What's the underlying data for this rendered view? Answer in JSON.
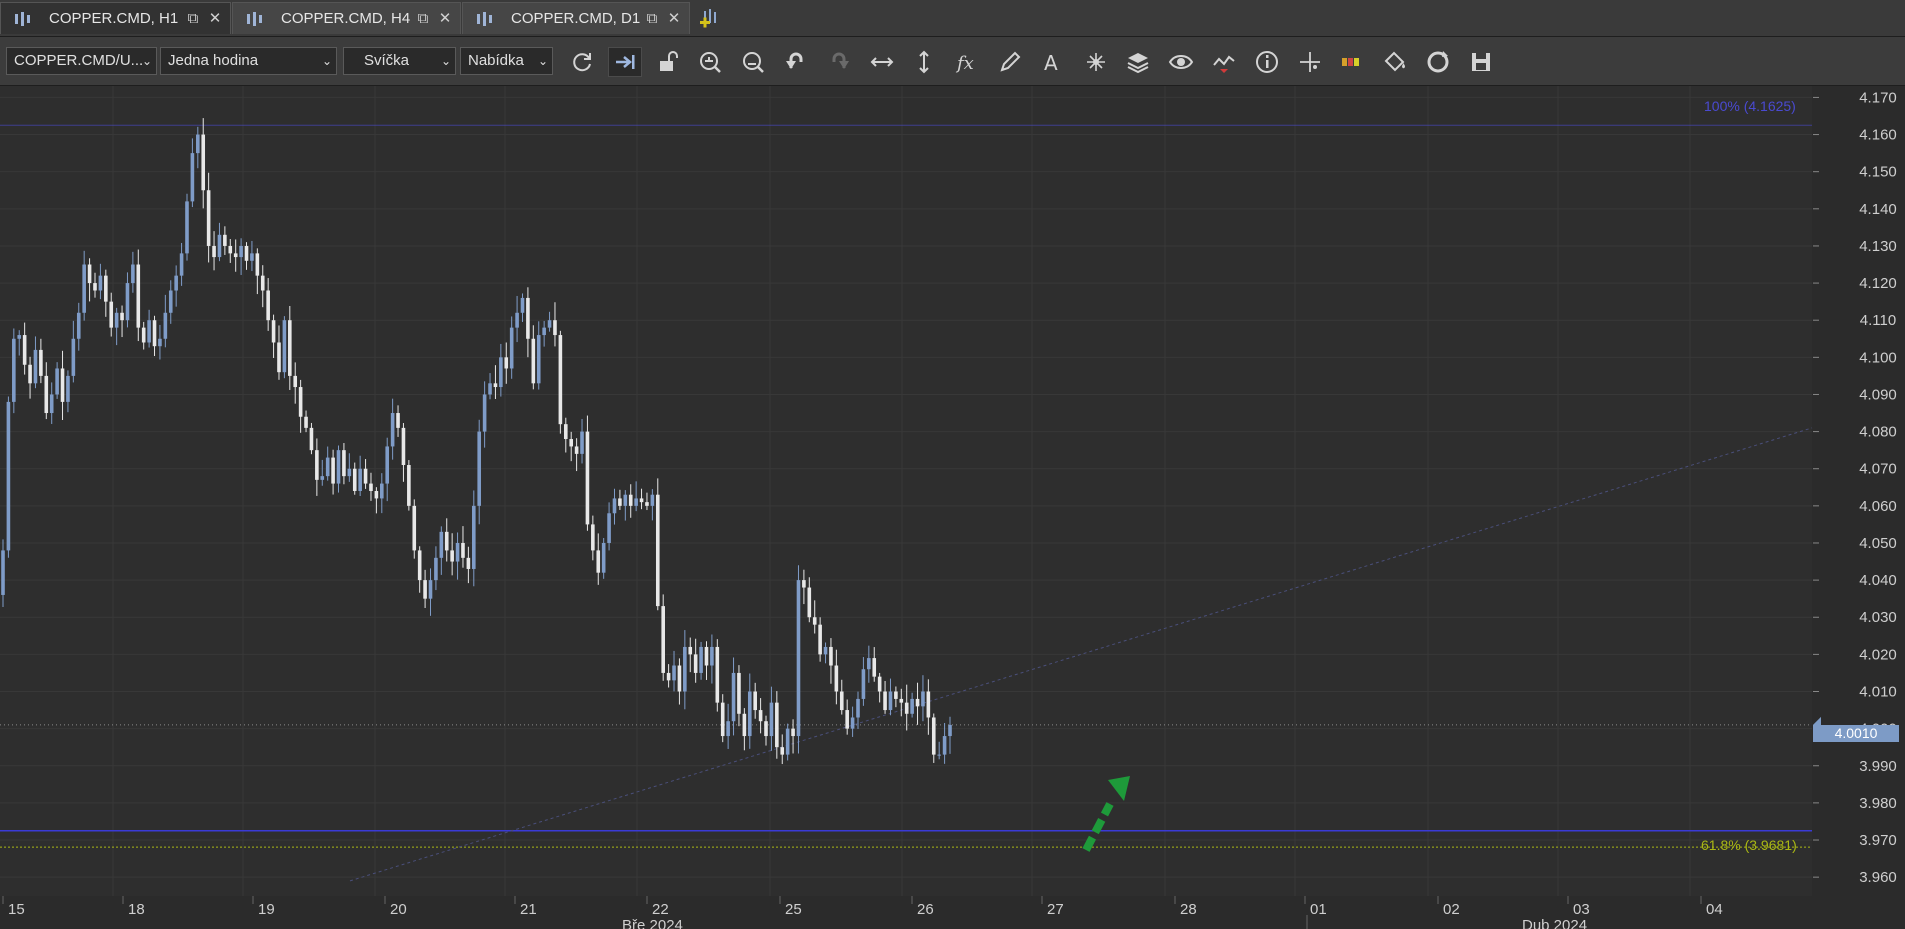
{
  "tabs": [
    {
      "label": "COPPER.CMD, H1",
      "active": true
    },
    {
      "label": "COPPER.CMD, H4",
      "active": false
    },
    {
      "label": "COPPER.CMD, D1",
      "active": false
    }
  ],
  "toolbar": {
    "instrument": "COPPER.CMD/U...",
    "period": "Jedna hodina",
    "chart_type": "Svíčka",
    "side": "Nabídka",
    "icons": [
      "refresh-icon",
      "autoshift-icon",
      "unlock-icon",
      "zoom-in-icon",
      "zoom-out-icon",
      "undo-icon",
      "redo-icon",
      "fit-horizontal-icon",
      "fit-vertical-icon",
      "indicators-icon",
      "pencil-icon",
      "text-icon",
      "objects-icon",
      "layers-icon",
      "eye-icon",
      "strategy-icon",
      "info-icon",
      "crosshair-icon",
      "heatmap-icon",
      "paint-bucket-icon",
      "reload-icon",
      "save-icon"
    ]
  },
  "chart_data": {
    "type": "candlestick",
    "instrument": "COPPER.CMD",
    "timeframe": "H1",
    "ylim": [
      3.956,
      4.172
    ],
    "y_ticks": [
      "4.170",
      "4.160",
      "4.150",
      "4.140",
      "4.130",
      "4.120",
      "4.110",
      "4.100",
      "4.090",
      "4.080",
      "4.070",
      "4.060",
      "4.050",
      "4.040",
      "4.030",
      "4.020",
      "4.010",
      "4.000",
      "3.990",
      "3.980",
      "3.970",
      "3.960"
    ],
    "x_ticks": [
      "15",
      "18",
      "19",
      "20",
      "21",
      "22",
      "25",
      "26",
      "27",
      "28",
      "01",
      "02",
      "03",
      "04"
    ],
    "x_groups": [
      "Bře 2024",
      "Dub 2024"
    ],
    "current_price": "4.0010",
    "fib_levels": [
      {
        "label": "100% (4.1625)",
        "value": 4.1625,
        "color": "#4a4ad0"
      },
      {
        "label": "61.8% (3.9681)",
        "value": 3.9681,
        "color": "#aab814"
      }
    ],
    "horizontal_line": {
      "value": 3.9725,
      "color": "#3a3ad6"
    },
    "trend_line": {
      "from": [
        "20",
        3.959
      ],
      "to": [
        "04+",
        4.081
      ]
    },
    "arrow": {
      "direction": "up",
      "color": "#1e9a3a"
    },
    "closes": [
      4.048,
      4.088,
      4.105,
      4.106,
      4.098,
      4.093,
      4.102,
      4.095,
      4.085,
      4.09,
      4.097,
      4.088,
      4.095,
      4.105,
      4.112,
      4.125,
      4.12,
      4.118,
      4.122,
      4.115,
      4.108,
      4.112,
      4.11,
      4.12,
      4.125,
      4.108,
      4.104,
      4.11,
      4.103,
      4.105,
      4.112,
      4.118,
      4.122,
      4.128,
      4.142,
      4.155,
      4.16,
      4.145,
      4.13,
      4.127,
      4.133,
      4.13,
      4.128,
      4.127,
      4.13,
      4.126,
      4.128,
      4.122,
      4.118,
      4.11,
      4.104,
      4.096,
      4.11,
      4.095,
      4.092,
      4.084,
      4.081,
      4.075,
      4.067,
      4.068,
      4.073,
      4.066,
      4.075,
      4.068,
      4.07,
      4.064,
      4.07,
      4.066,
      4.064,
      4.062,
      4.066,
      4.076,
      4.085,
      4.081,
      4.071,
      4.06,
      4.048,
      4.04,
      4.035,
      4.04,
      4.046,
      4.053,
      4.048,
      4.045,
      4.05,
      4.046,
      4.043,
      4.06,
      4.08,
      4.09,
      4.093,
      4.092,
      4.1,
      4.097,
      4.108,
      4.112,
      4.116,
      4.105,
      4.093,
      4.106,
      4.108,
      4.11,
      4.106,
      4.082,
      4.078,
      4.076,
      4.074,
      4.08,
      4.055,
      4.048,
      4.042,
      4.05,
      4.058,
      4.062,
      4.06,
      4.063,
      4.06,
      4.062,
      4.061,
      4.06,
      4.063,
      4.033,
      4.015,
      4.013,
      4.017,
      4.01,
      4.022,
      4.02,
      4.015,
      4.022,
      4.017,
      4.022,
      4.007,
      3.998,
      4.002,
      4.015,
      4.004,
      3.998,
      4.01,
      4.005,
      4.002,
      3.998,
      4.007,
      3.995,
      3.993,
      4.0,
      3.998,
      4.04,
      4.038,
      4.03,
      4.028,
      4.02,
      4.022,
      4.017,
      4.01,
      4.005,
      4.0,
      4.003,
      4.008,
      4.016,
      4.019,
      4.014,
      4.01,
      4.005,
      4.01,
      4.008,
      4.007,
      4.004,
      4.008,
      4.006,
      4.01,
      4.003,
      3.993,
      3.993,
      3.998,
      4.001
    ]
  }
}
